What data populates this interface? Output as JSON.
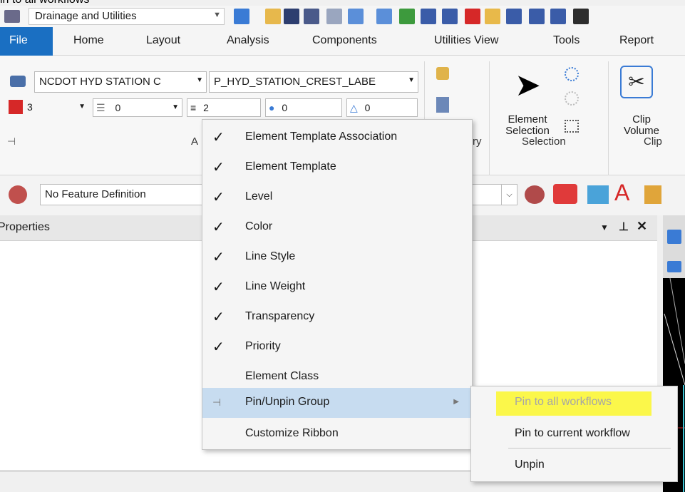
{
  "caption_fragment": "in to all workflows",
  "quick_access": {
    "workflow": "Drainage and Utilities"
  },
  "tabs": [
    {
      "label": "File"
    },
    {
      "label": "Home"
    },
    {
      "label": "Layout"
    },
    {
      "label": "Analysis"
    },
    {
      "label": "Components"
    },
    {
      "label": "Utilities View"
    },
    {
      "label": "Tools"
    },
    {
      "label": "Report"
    }
  ],
  "ribbon": {
    "element_template": "NCDOT HYD STATION C",
    "level": "P_HYD_STATION_CREST_LABE",
    "color_value": "3",
    "style_value": "0",
    "weight_value": "2",
    "transparency_value": "0",
    "priority_value": "0",
    "group_attributes_partial": "A",
    "group_primary_partial": "ry",
    "element_selection_label": "Element Selection",
    "group_selection": "Selection",
    "clip_volume_label": "Clip Volume",
    "group_clip": "Clip"
  },
  "feature": {
    "definition": "No Feature Definition"
  },
  "properties": {
    "title": "Properties"
  },
  "context_menu": {
    "items": [
      {
        "label": "Element Template Association",
        "checked": true
      },
      {
        "label": "Element Template",
        "checked": true
      },
      {
        "label": "Level",
        "checked": true
      },
      {
        "label": "Color",
        "checked": true
      },
      {
        "label": "Line Style",
        "checked": true
      },
      {
        "label": "Line Weight",
        "checked": true
      },
      {
        "label": "Transparency",
        "checked": true
      },
      {
        "label": "Priority",
        "checked": true
      },
      {
        "label": "Element Class",
        "checked": false
      },
      {
        "label": "Pin/Unpin Group",
        "checked": false,
        "submenu": true
      },
      {
        "label": "Customize Ribbon",
        "checked": false
      }
    ]
  },
  "submenu": {
    "items": [
      {
        "label": "Pin to all workflows",
        "disabled": true,
        "highlighted": true
      },
      {
        "label": "Pin to current workflow",
        "disabled": false
      },
      {
        "label": "Unpin",
        "disabled": false
      }
    ]
  },
  "colors": {
    "file_tab": "#1a6fc2",
    "menu_highlight": "#c7dcf0",
    "yellow_highlight": "#fbf74a",
    "check": "#111111"
  }
}
